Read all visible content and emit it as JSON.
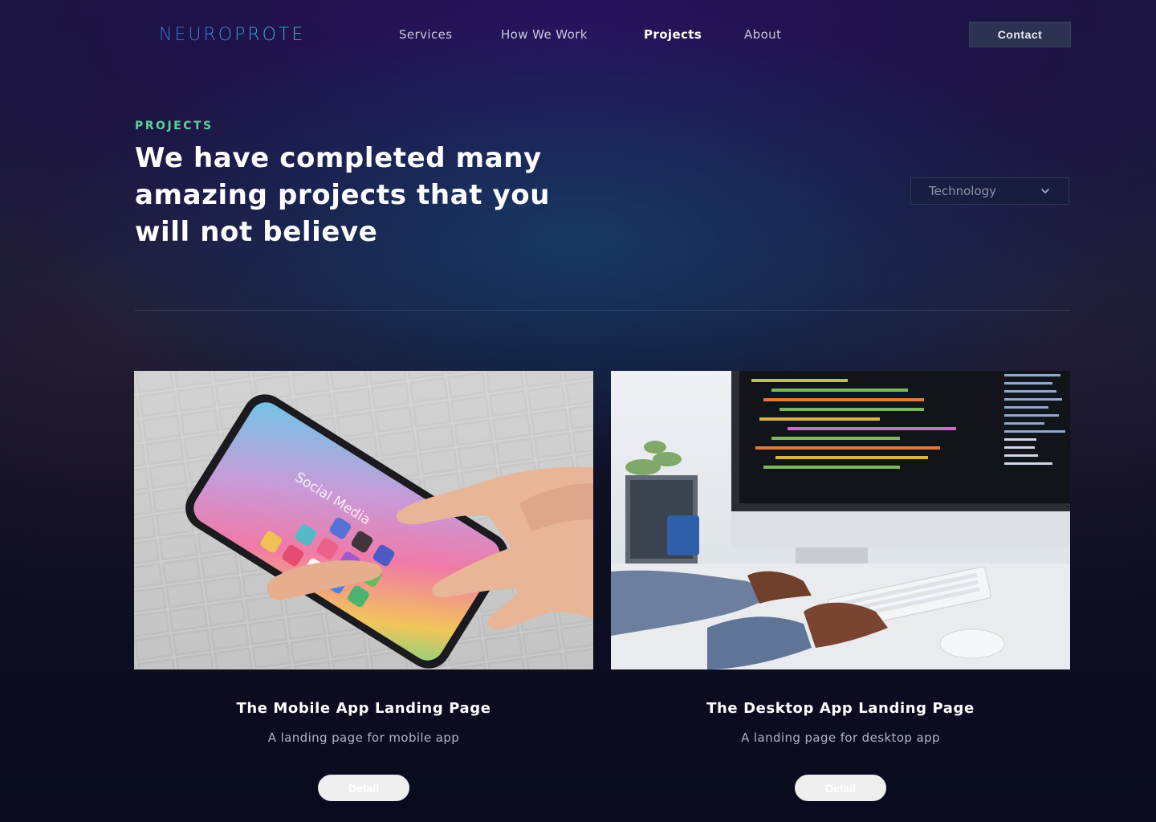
{
  "brand": {
    "logo_text": "NEUROPROTE"
  },
  "nav": {
    "links": [
      {
        "label": "Services"
      },
      {
        "label": "How We Work"
      },
      {
        "label": "Projects",
        "active": true
      },
      {
        "label": "About"
      }
    ],
    "contact_label": "Contact"
  },
  "hero": {
    "eyebrow": "PROJECTS",
    "headline_lines": [
      "We have completed many",
      "amazing projects that you",
      "will not believe"
    ]
  },
  "filter": {
    "selected": "Technology",
    "icon": "chevron-down-icon"
  },
  "projects": [
    {
      "title": "The Mobile App Landing Page",
      "description": "A landing page for mobile app",
      "button": "Detail",
      "image": "hand-holding-smartphone-social-media",
      "screen_text": "Social Media"
    },
    {
      "title": "The Desktop App Landing Page",
      "description": "A landing page for desktop app",
      "button": "Detail",
      "image": "person-typing-at-desktop-with-code"
    }
  ],
  "colors": {
    "accent_green": "#58d49a",
    "logo_blue": "#3b6fd6",
    "logo_teal": "#33c2b8",
    "contact_bg": "#2c3350"
  }
}
